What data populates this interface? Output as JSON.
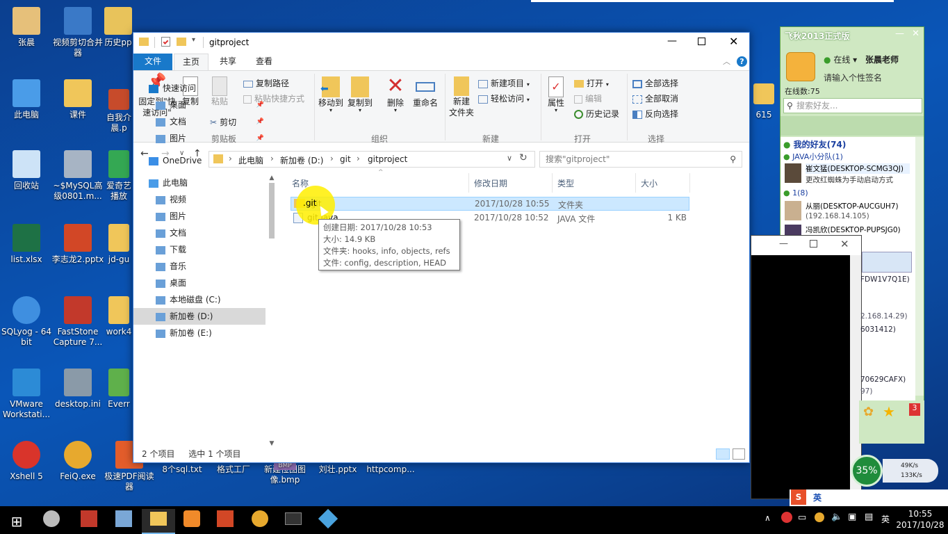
{
  "desktop": {
    "icons": [
      {
        "label": "张晨",
        "color": "#e6c07a"
      },
      {
        "label": "视频剪切合并器",
        "color": "#3a79c7"
      },
      {
        "label": "历史pp",
        "color": "#e8c35b"
      },
      {
        "label": "此电脑",
        "color": "#4a9ce8"
      },
      {
        "label": "课件",
        "color": "#f0c65a"
      },
      {
        "label": "自我介晨.p",
        "color": "#c74b2b"
      },
      {
        "label": "回收站",
        "color": "#cde3f7"
      },
      {
        "label": "~$MySQL高级0801.m...",
        "color": "#a7b4c4"
      },
      {
        "label": "爱奇艺播放",
        "color": "#34a853"
      },
      {
        "label": "list.xlsx",
        "color": "#1e7145"
      },
      {
        "label": "李志龙2.pptx",
        "color": "#d24726"
      },
      {
        "label": "jd-gu",
        "color": "#f0c65a"
      },
      {
        "label": "SQLyog - 64 bit",
        "color": "#3f8fe0"
      },
      {
        "label": "FastStone Capture 7...",
        "color": "#c2392b"
      },
      {
        "label": "work4",
        "color": "#f0c65a"
      },
      {
        "label": "VMware Workstati...",
        "color": "#2c8bd6"
      },
      {
        "label": "desktop.ini",
        "color": "#8a9aa8"
      },
      {
        "label": "Everr",
        "color": "#5fb04b"
      },
      {
        "label": "Xshell 5",
        "color": "#d9342b"
      },
      {
        "label": "FeiQ.exe",
        "color": "#e7a92e"
      },
      {
        "label": "极速PDF阅读器",
        "color": "#e35d2b"
      },
      {
        "label": "8个sql.txt",
        "color": "#ffffff"
      },
      {
        "label": "格式工厂",
        "color": "#3d6fb5"
      },
      {
        "label": "新建位图图像.bmp",
        "color": "#8c6bb1"
      },
      {
        "label": "刘壮.pptx",
        "color": "#d24726"
      },
      {
        "label": "httpcomp...",
        "color": "#cfd8e3"
      },
      {
        "label": "615",
        "color": "#f0c65a"
      }
    ]
  },
  "explorer": {
    "title": "gitproject",
    "tabs": [
      "文件",
      "主页",
      "共享",
      "查看"
    ],
    "ribbon": {
      "clipboard": {
        "pin": "固定到\"快速访问\"",
        "copy": "复制",
        "paste": "粘贴",
        "copy_path": "复制路径",
        "paste_shortcut": "粘贴快捷方式",
        "cut": "剪切",
        "group": "剪贴板"
      },
      "organize": {
        "move_to": "移动到",
        "copy_to": "复制到",
        "delete": "删除",
        "rename": "重命名",
        "group": "组织"
      },
      "new": {
        "new_folder": "新建\n文件夹",
        "new_item": "新建项目",
        "easy_access": "轻松访问",
        "group": "新建"
      },
      "open": {
        "properties": "属性",
        "open": "打开",
        "edit": "编辑",
        "history": "历史记录",
        "group": "打开"
      },
      "select": {
        "select_all": "全部选择",
        "select_none": "全部取消",
        "invert": "反向选择",
        "group": "选择"
      }
    },
    "breadcrumb": [
      "此电脑",
      "新加卷 (D:)",
      "git",
      "gitproject"
    ],
    "search_placeholder": "搜索\"gitproject\"",
    "nav": [
      {
        "label": "快速访问",
        "indent": 0,
        "pin": false
      },
      {
        "label": "桌面",
        "indent": 1,
        "pin": true
      },
      {
        "label": "文档",
        "indent": 1,
        "pin": true
      },
      {
        "label": "图片",
        "indent": 1,
        "pin": true
      },
      {
        "label": "OneDrive",
        "indent": 0,
        "pin": false
      },
      {
        "label": "此电脑",
        "indent": 0,
        "pin": false
      },
      {
        "label": "视频",
        "indent": 1,
        "pin": false
      },
      {
        "label": "图片",
        "indent": 1,
        "pin": false
      },
      {
        "label": "文档",
        "indent": 1,
        "pin": false
      },
      {
        "label": "下载",
        "indent": 1,
        "pin": false
      },
      {
        "label": "音乐",
        "indent": 1,
        "pin": false
      },
      {
        "label": "桌面",
        "indent": 1,
        "pin": false
      },
      {
        "label": "本地磁盘 (C:)",
        "indent": 1,
        "pin": false
      },
      {
        "label": "新加卷 (D:)",
        "indent": 1,
        "pin": false
      },
      {
        "label": "新加卷 (E:)",
        "indent": 1,
        "pin": false
      }
    ],
    "columns": [
      "名称",
      "修改日期",
      "类型",
      "大小"
    ],
    "files": [
      {
        "name": ".git",
        "date": "2017/10/28 10:55",
        "type": "文件夹",
        "size": ""
      },
      {
        "name": "git.java",
        "date": "2017/10/28 10:52",
        "type": "JAVA 文件",
        "size": "1 KB"
      }
    ],
    "tooltip": [
      "创建日期: 2017/10/28 10:53",
      "大小: 14.9 KB",
      "文件夹: hooks, info, objects, refs",
      "文件: config, description, HEAD"
    ],
    "status": {
      "count": "2 个项目",
      "selected": "选中 1 个项目"
    }
  },
  "feiq": {
    "title": "飞秋2013正式版",
    "status": "在线",
    "user": "张晨老师",
    "signature": "请输入个性签名",
    "online_count": "在线数:75",
    "search_placeholder": "搜索好友...",
    "groups": [
      {
        "label": "我的好友(74)"
      },
      {
        "label": "JAVA小分队(1)"
      }
    ],
    "entries": [
      {
        "name": "崔文猛(DESKTOP-SCMG3QJ)",
        "sub": "更改红蜘蛛为手动启动方式"
      },
      {
        "name": "1(8)",
        "sub": ""
      },
      {
        "name": "从丽(DESKTOP-AUCGUH7)",
        "sub": "(192.168.14.105)"
      },
      {
        "name": "冯凯欣(DESKTOP-PUPSJG0)",
        "sub": ""
      }
    ],
    "partials": [
      "FDW1V7Q1E)",
      "2.168.14.29)",
      "6031412)",
      "70629CAFX)",
      "97)"
    ]
  },
  "netmeter": {
    "percent": "35%",
    "up": "49K/s",
    "down": "133K/s"
  },
  "taskbar": {
    "time": "10:55",
    "date": "2017/10/28",
    "ime": "英"
  }
}
